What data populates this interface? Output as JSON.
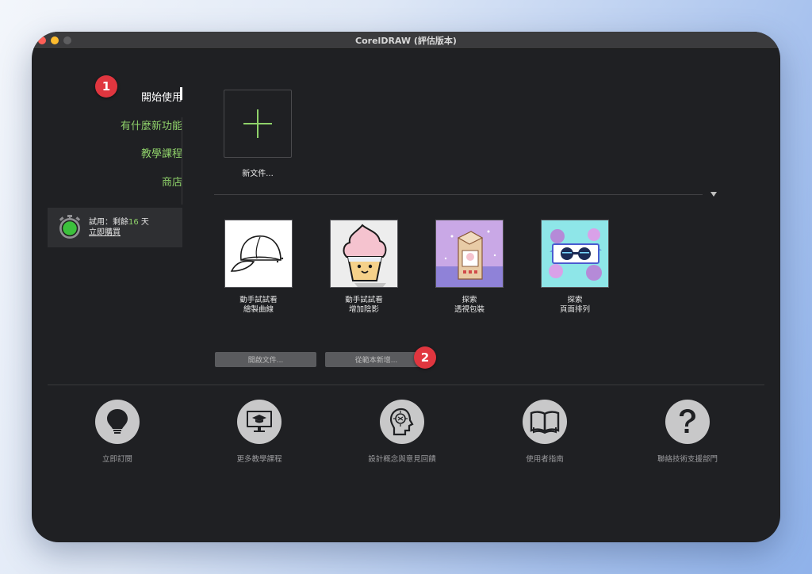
{
  "window": {
    "title": "CorelDRAW (評估版本)"
  },
  "nav": {
    "items": [
      {
        "label": "開始使用",
        "active": true
      },
      {
        "label": "有什麼新功能"
      },
      {
        "label": "教學課程"
      },
      {
        "label": "商店"
      }
    ]
  },
  "trial": {
    "prefix": "試用：剩餘",
    "days": "16",
    "suffix": " 天",
    "buy_link": "立即購買"
  },
  "badges": {
    "one": "1",
    "two": "2"
  },
  "new_document": {
    "label": "新文件..."
  },
  "tiles": [
    {
      "line1": "動手試試看",
      "line2": "繪製曲線",
      "icon": "baseball-cap"
    },
    {
      "line1": "動手試試看",
      "line2": "增加陰影",
      "icon": "cupcake"
    },
    {
      "line1": "探索",
      "line2": "透視包裝",
      "icon": "milk-carton"
    },
    {
      "line1": "探索",
      "line2": "頁面排列",
      "icon": "glasses-flowers"
    }
  ],
  "buttons": {
    "open": "開啟文件...",
    "from_template": "從範本新增..."
  },
  "bottom": [
    {
      "label": "立即訂閱",
      "icon": "lightbulb-icon"
    },
    {
      "label": "更多教學課程",
      "icon": "monitor-graduation-icon"
    },
    {
      "label": "設計概念與意見回饋",
      "icon": "head-brain-icon"
    },
    {
      "label": "使用者指南",
      "icon": "open-book-icon"
    },
    {
      "label": "聯絡技術支援部門",
      "icon": "question-icon"
    }
  ],
  "colors": {
    "accent_green": "#8fd16a",
    "badge_red": "#e0363f",
    "window_bg": "#1f2023"
  }
}
